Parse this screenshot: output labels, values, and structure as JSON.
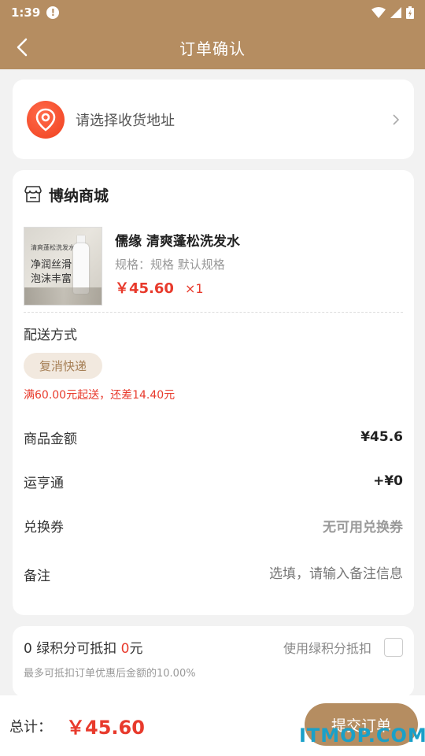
{
  "status_bar": {
    "time": "1:39",
    "alert": "!"
  },
  "header": {
    "title": "订单确认"
  },
  "address": {
    "placeholder_text": "请选择收货地址"
  },
  "shop": {
    "name": "博纳商城",
    "product": {
      "name": "儒缘 清爽蓬松洗发水",
      "spec": "规格：规格 默认规格",
      "price": "￥45.60",
      "qty": "×1",
      "image_text": [
        "清爽蓬松洗发水",
        "净润丝滑",
        "泡沫丰富"
      ]
    },
    "delivery": {
      "label": "配送方式",
      "option": "复消快递",
      "notice": "满60.00元起送，还差14.40元"
    },
    "rows": {
      "goods_amount": {
        "label": "商品金额",
        "value": "¥45.6"
      },
      "yunheng": {
        "label": "运亨通",
        "value": "+¥0"
      },
      "coupon": {
        "label": "兑换券",
        "value": "无可用兑换券"
      },
      "remark": {
        "label": "备注",
        "placeholder": "选填，请输入备注信息"
      }
    }
  },
  "points": {
    "prefix": "0 绿积分可抵扣 ",
    "amount": "0",
    "suffix": "元",
    "use_label": "使用绿积分抵扣",
    "sub": "最多可抵扣订单优惠后金额的10.00%"
  },
  "footer": {
    "total_label": "总计：",
    "total_value": "￥45.60",
    "submit_label": "提交订单"
  },
  "watermark": "ITMOP.COM",
  "colors": {
    "brand": "#b58d61",
    "price_red": "#e83a2c"
  }
}
